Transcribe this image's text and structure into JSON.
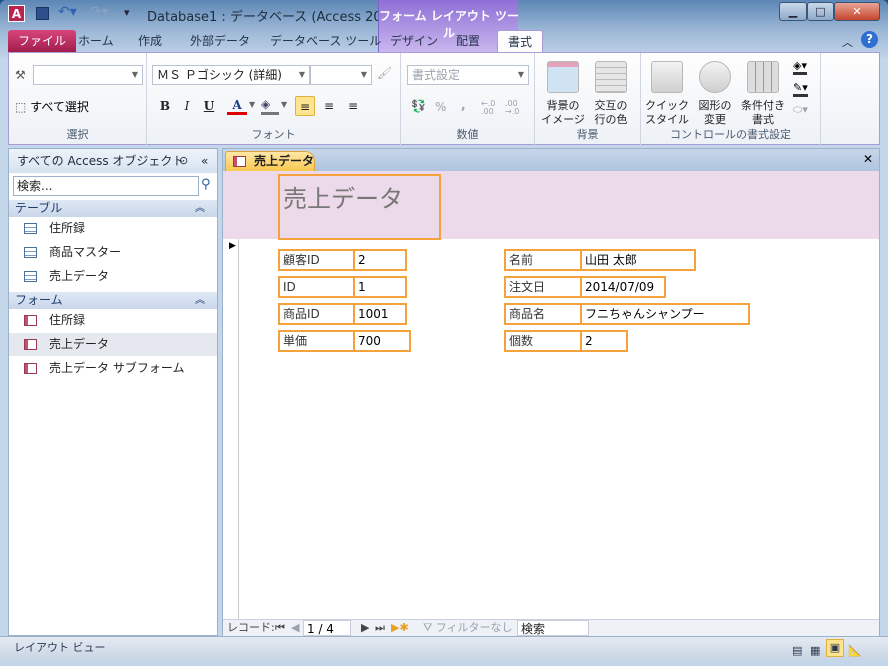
{
  "window": {
    "title": "Database1 : データベース (Access 200...",
    "context_title": "フォーム レイアウト ツール",
    "controls": {
      "minimize": "▁",
      "maximize": "□",
      "close": "✕"
    }
  },
  "tabs": [
    {
      "label": "ファイル"
    },
    {
      "label": "ホーム"
    },
    {
      "label": "作成"
    },
    {
      "label": "外部データ"
    },
    {
      "label": "データベース ツール"
    },
    {
      "label": "デザイン"
    },
    {
      "label": "配置"
    },
    {
      "label": "書式"
    }
  ],
  "ribbon": {
    "selection": {
      "label": "選択",
      "combo_value": "",
      "select_all": "すべて選択"
    },
    "font": {
      "label": "フォント",
      "font_name": "ＭＳ Ｐゴシック (詳細)",
      "font_size": "",
      "bold": "B",
      "italic": "I",
      "underline": "U",
      "font_color": "A",
      "font_color_hex": "#e00000"
    },
    "number": {
      "label": "数値",
      "format": "書式設定",
      "percent": "%",
      "comma": ",",
      "inc_decimal": "←.0 .00",
      "dec_decimal": ".00 →.0"
    },
    "background": {
      "label": "背景",
      "bg_image": "背景の\nイメージ",
      "alt_row_color": "交互の\n行の色"
    },
    "control_format": {
      "label": "コントロールの書式設定",
      "quick_style": "クイック\nスタイル",
      "change_shape": "図形の\n変更",
      "conditional": "条件付き\n書式"
    }
  },
  "nav": {
    "title": "すべての Access オブジェクト",
    "search_placeholder": "検索...",
    "sections": [
      {
        "label": "テーブル",
        "items": [
          "住所録",
          "商品マスター",
          "売上データ"
        ]
      },
      {
        "label": "フォーム",
        "items": [
          "住所録",
          "売上データ",
          "売上データ サブフォーム"
        ]
      }
    ],
    "selected": "売上データ"
  },
  "document": {
    "tab": "売上データ",
    "form_title": "売上データ",
    "fields_left": [
      {
        "label": "顧客ID",
        "value": "2"
      },
      {
        "label": "ID",
        "value": "1"
      },
      {
        "label": "商品ID",
        "value": "1001"
      },
      {
        "label": "単価",
        "value": "700"
      }
    ],
    "fields_right": [
      {
        "label": "名前",
        "value": "山田 太郎"
      },
      {
        "label": "注文日",
        "value": "2014/07/09"
      },
      {
        "label": "商品名",
        "value": "フニちゃんシャンプー"
      },
      {
        "label": "個数",
        "value": "2"
      }
    ],
    "record_nav": {
      "label": "レコード:",
      "position": "1 / 4",
      "filter": "フィルターなし",
      "search": "検索"
    }
  },
  "status": {
    "text": "レイアウト ビュー",
    "active_view": "layout"
  },
  "colors": {
    "accent_orange": "#f6a23c",
    "header_pink": "#ecd9ea",
    "file_tab": "#c02c60",
    "context_purple": "#8f6fd6"
  }
}
